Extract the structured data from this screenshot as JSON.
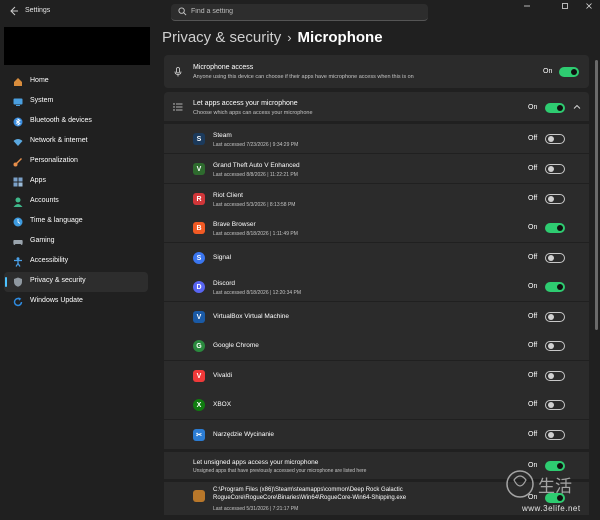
{
  "window": {
    "title": "Settings",
    "back_icon": "arrow-left-icon",
    "controls": [
      "minimize-icon",
      "maximize-icon",
      "close-icon"
    ]
  },
  "search": {
    "placeholder": "Find a setting"
  },
  "sidebar": {
    "items": [
      {
        "label": "Home",
        "icon": "home-icon",
        "color": "#d88c3c"
      },
      {
        "label": "System",
        "icon": "system-icon",
        "color": "#4a9fe0"
      },
      {
        "label": "Bluetooth & devices",
        "icon": "bluetooth-icon",
        "color": "#3b8ee0"
      },
      {
        "label": "Network & internet",
        "icon": "wifi-icon",
        "color": "#5aa8e0"
      },
      {
        "label": "Personalization",
        "icon": "brush-icon",
        "color": "#e88f4a"
      },
      {
        "label": "Apps",
        "icon": "apps-icon",
        "color": "#7aa0c8"
      },
      {
        "label": "Accounts",
        "icon": "accounts-icon",
        "color": "#3fb88a"
      },
      {
        "label": "Time & language",
        "icon": "clock-icon",
        "color": "#3d9be0"
      },
      {
        "label": "Gaming",
        "icon": "gaming-icon",
        "color": "#9aa4ad"
      },
      {
        "label": "Accessibility",
        "icon": "accessibility-icon",
        "color": "#4aa0e8"
      },
      {
        "label": "Privacy & security",
        "icon": "shield-icon",
        "color": "#8f98a0",
        "active": true
      },
      {
        "label": "Windows Update",
        "icon": "update-icon",
        "color": "#2e8be0"
      }
    ]
  },
  "breadcrumb": {
    "parent": "Privacy & security",
    "separator": "›",
    "current": "Microphone"
  },
  "mic_access": {
    "icon": "microphone-icon",
    "title": "Microphone access",
    "desc": "Anyone using this device can choose if their apps have microphone access when this is on",
    "state": "On"
  },
  "let_apps": {
    "icon": "list-icon",
    "title": "Let apps access your microphone",
    "desc": "Choose which apps can access your microphone",
    "state": "On",
    "chevron": "chevron-up-icon"
  },
  "apps": [
    {
      "name": "Steam",
      "meta": "Last accessed 7/23/2026  |  9:34:29 PM",
      "state": "Off",
      "icon": "steam-icon",
      "color": "#1b3a5c",
      "glyph": "S"
    },
    {
      "name": "Grand Theft Auto V Enhanced",
      "meta": "Last accessed 8/8/2026  |  11:22:21 PM",
      "state": "Off",
      "icon": "gta-icon",
      "color": "#2e6b2e",
      "glyph": "V"
    },
    {
      "name": "Riot Client",
      "meta": "Last accessed 5/3/2026  |  8:13:58 PM",
      "state": "Off",
      "icon": "riot-icon",
      "color": "#d13639",
      "glyph": "R"
    },
    {
      "name": "Brave Browser",
      "meta": "Last accessed 8/18/2026  |  1:11:49 PM",
      "state": "On",
      "icon": "brave-icon",
      "color": "#f15a24",
      "glyph": "B"
    },
    {
      "name": "Signal",
      "meta": "",
      "state": "Off",
      "icon": "signal-icon",
      "color": "#3a76f0",
      "glyph": "S"
    },
    {
      "name": "Discord",
      "meta": "Last accessed 8/18/2026  |  12:20:34 PM",
      "state": "On",
      "icon": "discord-icon",
      "color": "#5865f2",
      "glyph": "D"
    },
    {
      "name": "VirtualBox Virtual Machine",
      "meta": "",
      "state": "Off",
      "icon": "virtualbox-icon",
      "color": "#1a5aa6",
      "glyph": "V"
    },
    {
      "name": "Google Chrome",
      "meta": "",
      "state": "Off",
      "icon": "chrome-icon",
      "color": "#2a8a3e",
      "glyph": "G"
    },
    {
      "name": "Vivaldi",
      "meta": "",
      "state": "Off",
      "icon": "vivaldi-icon",
      "color": "#ef3939",
      "glyph": "V"
    },
    {
      "name": "XBOX",
      "meta": "",
      "state": "Off",
      "icon": "xbox-icon",
      "color": "#107c10",
      "glyph": "X"
    },
    {
      "name": "Narzędzie Wycinanie",
      "meta": "",
      "state": "Off",
      "icon": "snipping-tool-icon",
      "color": "#2b7cd3",
      "glyph": "✂"
    }
  ],
  "unsigned": {
    "title": "Let unsigned apps access your microphone",
    "desc": "Unsigned apps that have previously accessed your microphone are listed here",
    "state": "On"
  },
  "unsigned_apps": [
    {
      "path": "C:\\Program Files (x86)\\Steam\\steamapps\\common\\Deep Rock Galactic RogueCore\\RogueCore\\Binaries\\Win64\\RogueCore-Win64-Shipping.exe",
      "meta": "Last accessed 5/31/2026  |  7:21:17 PM",
      "state": "On",
      "icon": "app-exe-icon",
      "color": "#b8772a"
    }
  ],
  "watermark": {
    "text": "www.3elife.net",
    "logo_text": "三易生活"
  },
  "colors": {
    "accent": "#4cc2ff",
    "toggle_on": "#2ecc71",
    "background": "#202020",
    "card": "#2b2b2b"
  }
}
